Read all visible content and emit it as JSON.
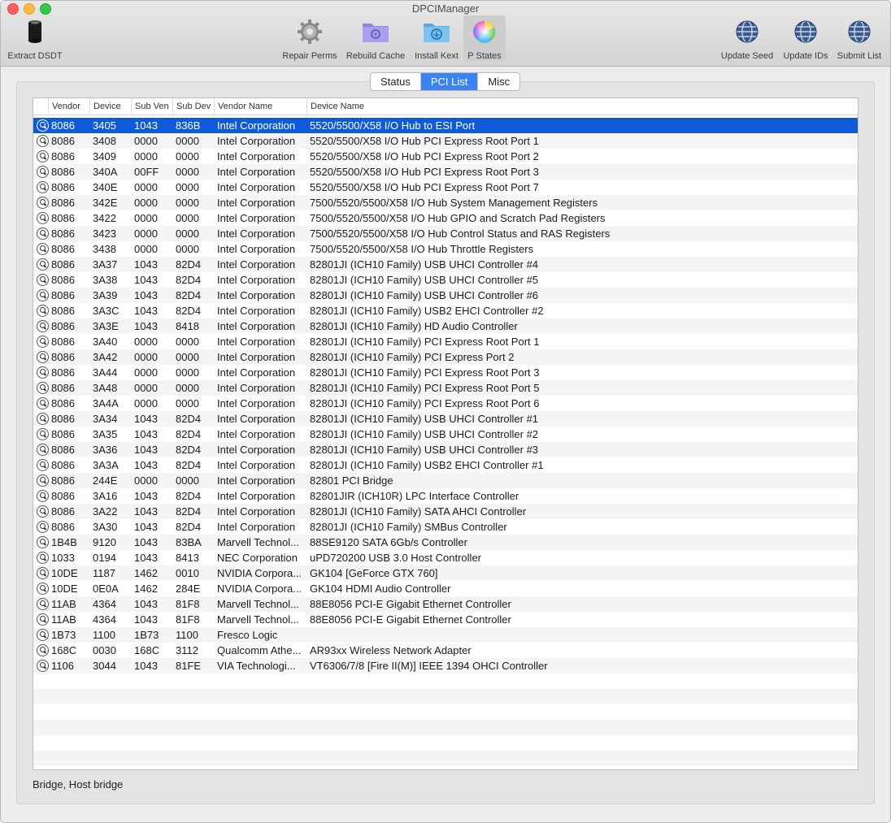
{
  "window": {
    "title": "DPCIManager"
  },
  "toolbar": {
    "extract_dsdt": "Extract DSDT",
    "repair_perms": "Repair Perms",
    "rebuild_cache": "Rebuild Cache",
    "install_kext": "Install Kext",
    "p_states": "P States",
    "update_seed": "Update Seed",
    "update_ids": "Update IDs",
    "submit_list": "Submit List"
  },
  "tabs": {
    "status": "Status",
    "pci_list": "PCI List",
    "misc": "Misc",
    "selected": "PCI List"
  },
  "columns": {
    "vendor": "Vendor",
    "device": "Device",
    "sub_ven": "Sub Ven",
    "sub_dev": "Sub Dev",
    "vendor_name": "Vendor Name",
    "device_name": "Device Name"
  },
  "rows": [
    [
      "8086",
      "3405",
      "1043",
      "836B",
      "Intel Corporation",
      "5520/5500/X58 I/O Hub to ESI Port"
    ],
    [
      "8086",
      "3408",
      "0000",
      "0000",
      "Intel Corporation",
      "5520/5500/X58 I/O Hub PCI Express Root Port 1"
    ],
    [
      "8086",
      "3409",
      "0000",
      "0000",
      "Intel Corporation",
      "5520/5500/X58 I/O Hub PCI Express Root Port 2"
    ],
    [
      "8086",
      "340A",
      "00FF",
      "0000",
      "Intel Corporation",
      "5520/5500/X58 I/O Hub PCI Express Root Port 3"
    ],
    [
      "8086",
      "340E",
      "0000",
      "0000",
      "Intel Corporation",
      "5520/5500/X58 I/O Hub PCI Express Root Port 7"
    ],
    [
      "8086",
      "342E",
      "0000",
      "0000",
      "Intel Corporation",
      "7500/5520/5500/X58 I/O Hub System Management Registers"
    ],
    [
      "8086",
      "3422",
      "0000",
      "0000",
      "Intel Corporation",
      "7500/5520/5500/X58 I/O Hub GPIO and Scratch Pad Registers"
    ],
    [
      "8086",
      "3423",
      "0000",
      "0000",
      "Intel Corporation",
      "7500/5520/5500/X58 I/O Hub Control Status and RAS Registers"
    ],
    [
      "8086",
      "3438",
      "0000",
      "0000",
      "Intel Corporation",
      "7500/5520/5500/X58 I/O Hub Throttle Registers"
    ],
    [
      "8086",
      "3A37",
      "1043",
      "82D4",
      "Intel Corporation",
      "82801JI (ICH10 Family) USB UHCI Controller #4"
    ],
    [
      "8086",
      "3A38",
      "1043",
      "82D4",
      "Intel Corporation",
      "82801JI (ICH10 Family) USB UHCI Controller #5"
    ],
    [
      "8086",
      "3A39",
      "1043",
      "82D4",
      "Intel Corporation",
      "82801JI (ICH10 Family) USB UHCI Controller #6"
    ],
    [
      "8086",
      "3A3C",
      "1043",
      "82D4",
      "Intel Corporation",
      "82801JI (ICH10 Family) USB2 EHCI Controller #2"
    ],
    [
      "8086",
      "3A3E",
      "1043",
      "8418",
      "Intel Corporation",
      "82801JI (ICH10 Family) HD Audio Controller"
    ],
    [
      "8086",
      "3A40",
      "0000",
      "0000",
      "Intel Corporation",
      "82801JI (ICH10 Family) PCI Express Root Port 1"
    ],
    [
      "8086",
      "3A42",
      "0000",
      "0000",
      "Intel Corporation",
      "82801JI (ICH10 Family) PCI Express Port 2"
    ],
    [
      "8086",
      "3A44",
      "0000",
      "0000",
      "Intel Corporation",
      "82801JI (ICH10 Family) PCI Express Root Port 3"
    ],
    [
      "8086",
      "3A48",
      "0000",
      "0000",
      "Intel Corporation",
      "82801JI (ICH10 Family) PCI Express Root Port 5"
    ],
    [
      "8086",
      "3A4A",
      "0000",
      "0000",
      "Intel Corporation",
      "82801JI (ICH10 Family) PCI Express Root Port 6"
    ],
    [
      "8086",
      "3A34",
      "1043",
      "82D4",
      "Intel Corporation",
      "82801JI (ICH10 Family) USB UHCI Controller #1"
    ],
    [
      "8086",
      "3A35",
      "1043",
      "82D4",
      "Intel Corporation",
      "82801JI (ICH10 Family) USB UHCI Controller #2"
    ],
    [
      "8086",
      "3A36",
      "1043",
      "82D4",
      "Intel Corporation",
      "82801JI (ICH10 Family) USB UHCI Controller #3"
    ],
    [
      "8086",
      "3A3A",
      "1043",
      "82D4",
      "Intel Corporation",
      "82801JI (ICH10 Family) USB2 EHCI Controller #1"
    ],
    [
      "8086",
      "244E",
      "0000",
      "0000",
      "Intel Corporation",
      "82801 PCI Bridge"
    ],
    [
      "8086",
      "3A16",
      "1043",
      "82D4",
      "Intel Corporation",
      "82801JIR (ICH10R) LPC Interface Controller"
    ],
    [
      "8086",
      "3A22",
      "1043",
      "82D4",
      "Intel Corporation",
      "82801JI (ICH10 Family) SATA AHCI Controller"
    ],
    [
      "8086",
      "3A30",
      "1043",
      "82D4",
      "Intel Corporation",
      "82801JI (ICH10 Family) SMBus Controller"
    ],
    [
      "1B4B",
      "9120",
      "1043",
      "83BA",
      "Marvell Technol...",
      "88SE9120 SATA 6Gb/s Controller"
    ],
    [
      "1033",
      "0194",
      "1043",
      "8413",
      "NEC Corporation",
      "uPD720200 USB 3.0 Host Controller"
    ],
    [
      "10DE",
      "1187",
      "1462",
      "0010",
      "NVIDIA Corpora...",
      "GK104 [GeForce GTX 760]"
    ],
    [
      "10DE",
      "0E0A",
      "1462",
      "284E",
      "NVIDIA Corpora...",
      "GK104 HDMI Audio Controller"
    ],
    [
      "11AB",
      "4364",
      "1043",
      "81F8",
      "Marvell Technol...",
      "88E8056 PCI-E Gigabit Ethernet Controller"
    ],
    [
      "11AB",
      "4364",
      "1043",
      "81F8",
      "Marvell Technol...",
      "88E8056 PCI-E Gigabit Ethernet Controller"
    ],
    [
      "1B73",
      "1100",
      "1B73",
      "1100",
      "Fresco Logic",
      ""
    ],
    [
      "168C",
      "0030",
      "168C",
      "3112",
      "Qualcomm Athe...",
      "AR93xx Wireless Network Adapter"
    ],
    [
      "1106",
      "3044",
      "1043",
      "81FE",
      "VIA Technologi...",
      "VT6306/7/8 [Fire II(M)] IEEE 1394 OHCI Controller"
    ]
  ],
  "selected_row": 0,
  "status_text": "Bridge, Host bridge",
  "colors": {
    "selection": "#0f5bd7",
    "tab_selected": "#3a83f0"
  }
}
